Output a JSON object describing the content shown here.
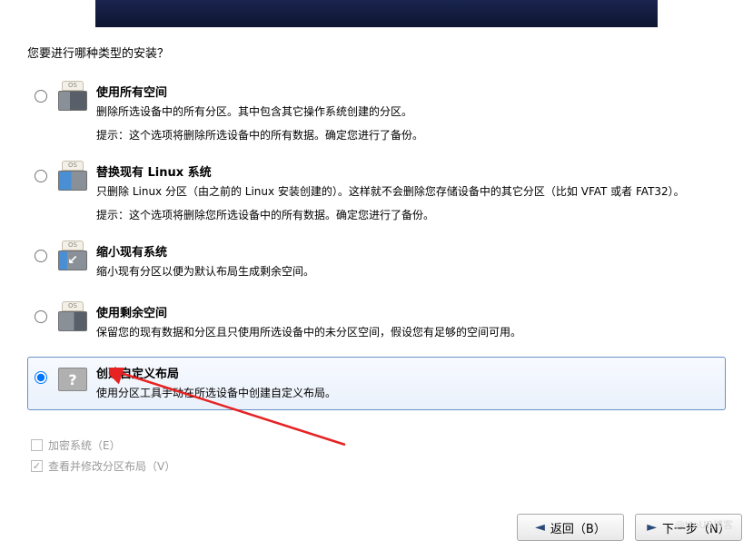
{
  "question": "您要进行哪种类型的安装？",
  "options": [
    {
      "title": "使用所有空间",
      "desc": "删除所选设备中的所有分区。其中包含其它操作系统创建的分区。",
      "hint": "提示：这个选项将删除所选设备中的所有数据。确定您进行了备份。"
    },
    {
      "title": "替换现有 Linux 系统",
      "desc": "只删除 Linux 分区（由之前的 Linux 安装创建的）。这样就不会删除您存储设备中的其它分区（比如 VFAT 或者 FAT32）。",
      "hint": "提示：这个选项将删除您所选设备中的所有数据。确定您进行了备份。"
    },
    {
      "title": "缩小现有系统",
      "desc": "缩小现有分区以便为默认布局生成剩余空间。",
      "hint": ""
    },
    {
      "title": "使用剩余空间",
      "desc": "保留您的现有数据和分区且只使用所选设备中的未分区空间，假设您有足够的空间可用。",
      "hint": ""
    },
    {
      "title": "创建自定义布局",
      "desc": "使用分区工具手动在所选设备中创建自定义布局。",
      "hint": ""
    }
  ],
  "checkboxes": {
    "encrypt": "加密系统（E）",
    "review": "查看并修改分区布局（V）"
  },
  "buttons": {
    "back": "返回（B）",
    "next": "下一步（N）"
  },
  "watermark": "@tteUB博客"
}
